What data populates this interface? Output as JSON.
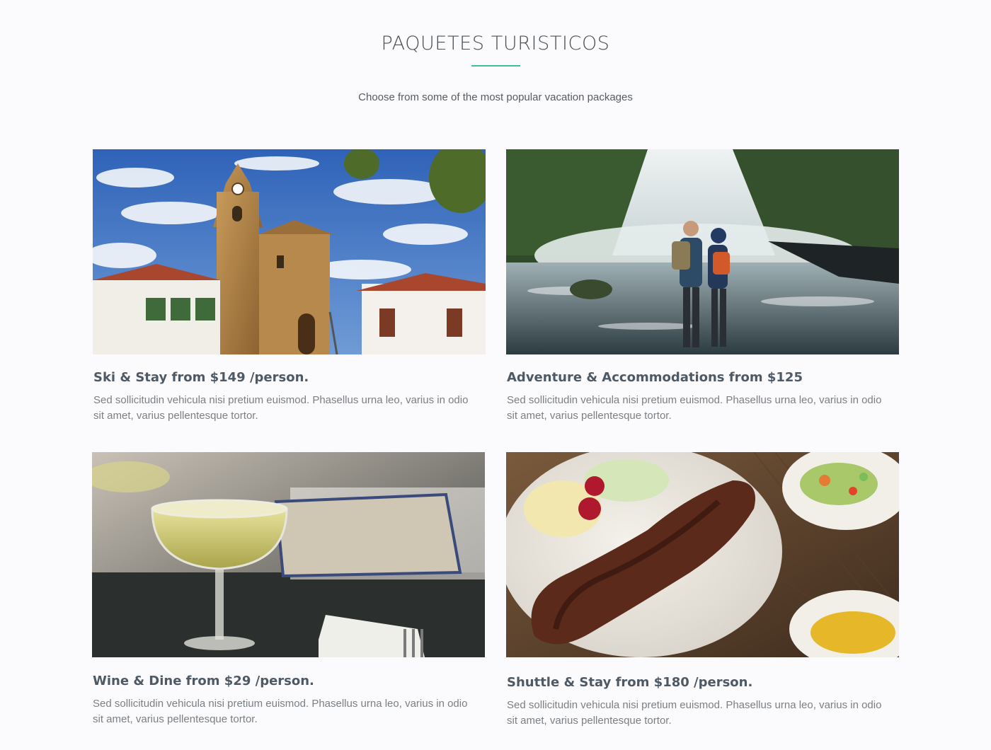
{
  "section": {
    "title": "PAQUETES TURISTICOS",
    "subtitle": "Choose from some of the most popular vacation packages"
  },
  "packages": [
    {
      "title": "Ski & Stay from $149 /person.",
      "description": "Sed sollicitudin vehicula nisi pretium euismod. Phasellus urna leo, varius in odio sit amet, varius pellentesque tortor.",
      "image": "colonial-church-photo"
    },
    {
      "title": "Adventure & Accommodations from $125",
      "description": "Sed sollicitudin vehicula nisi pretium euismod. Phasellus urna leo, varius in odio sit amet, varius pellentesque tortor.",
      "image": "waterfall-hikers-photo"
    },
    {
      "title": "Wine & Dine from $29 /person.",
      "description": "Sed sollicitudin vehicula nisi pretium euismod. Phasellus urna leo, varius in odio sit amet, varius pellentesque tortor.",
      "image": "cocktail-glass-photo"
    },
    {
      "title": "Shuttle & Stay from $180 /person.",
      "description": "Sed sollicitudin vehicula nisi pretium euismod. Phasellus urna leo, varius in odio sit amet, varius pellentesque tortor.",
      "image": "grilled-steak-plate-photo"
    }
  ],
  "colors": {
    "accent": "#3fbf9a",
    "title_text": "#4a4f55",
    "card_title": "#4e5966",
    "body_text": "#7b7f84",
    "background": "#fbfbfd"
  }
}
